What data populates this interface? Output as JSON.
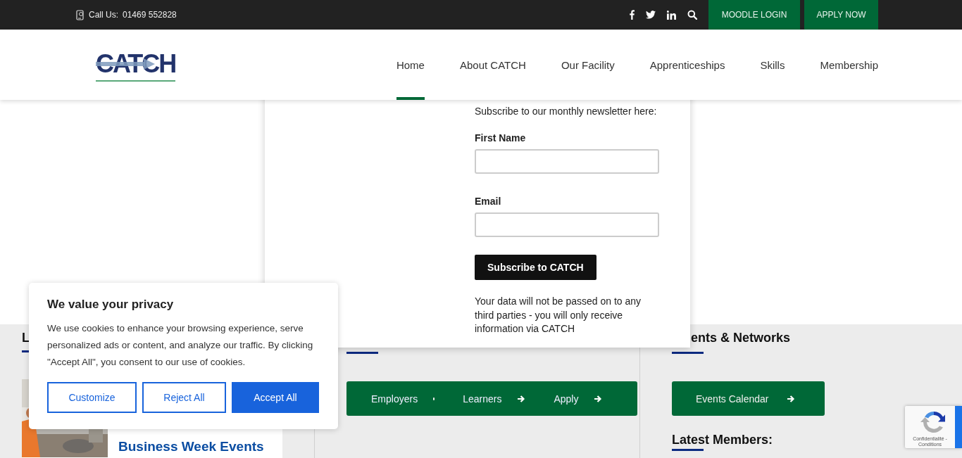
{
  "top_bar": {
    "phone_label": "Call Us:",
    "phone": "01469 552828",
    "buttons": [
      "MOODLE LOGIN",
      "APPLY NOW"
    ]
  },
  "header": {
    "logo": "CATCH",
    "nav": [
      {
        "label": "Home",
        "selected": true
      },
      {
        "label": "About CATCH",
        "selected": false
      },
      {
        "label": "Our Facility",
        "selected": false
      },
      {
        "label": "Apprenticeships",
        "selected": false
      },
      {
        "label": "Skills",
        "selected": false
      },
      {
        "label": "Membership",
        "selected": false
      }
    ]
  },
  "newsletter": {
    "intro": "Subscribe to our monthly newsletter here:",
    "fields": [
      {
        "label": "First Name"
      },
      {
        "label": "Email"
      }
    ],
    "button": "Subscribe to CATCH",
    "note": "Your data will not be passed on to any third parties - you will only receive information via CATCH"
  },
  "news_column": {
    "heading": "L",
    "article_title": [
      "Business Week Events"
    ]
  },
  "links_column": {
    "links": [
      {
        "label": "Employers",
        "arrow": false
      },
      {
        "label": "Learners",
        "arrow": true
      },
      {
        "label": "Apply",
        "arrow": true
      }
    ]
  },
  "events_column": {
    "heading": "ents & Networks",
    "button": "Events Calendar",
    "subheading": "Latest Members:"
  },
  "cookie_banner": {
    "title": "We value your privacy",
    "text": "We use cookies to enhance your browsing experience, serve personalized ads or content, and analyze our traffic. By clicking \"Accept All\", you consent to our use of cookies.",
    "buttons": [
      {
        "label": "Customize",
        "kind": "outline"
      },
      {
        "label": "Reject All",
        "kind": "outline"
      },
      {
        "label": "Accept All",
        "kind": "filled"
      }
    ]
  },
  "recaptcha": {
    "links": "Confidentialité - Conditions"
  }
}
